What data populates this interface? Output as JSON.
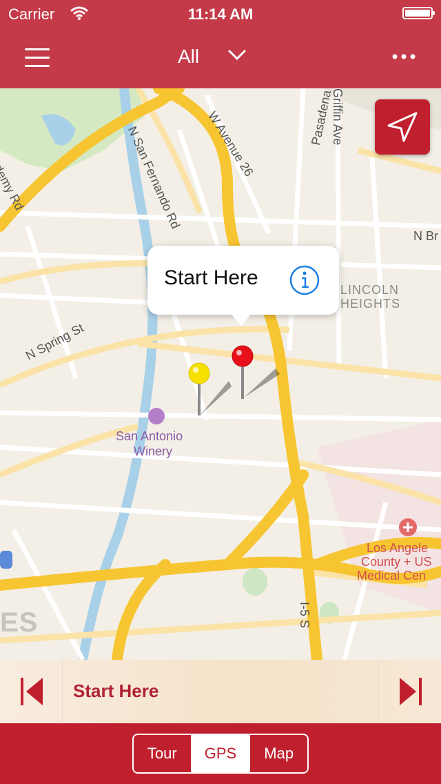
{
  "status_bar": {
    "carrier": "Carrier",
    "time": "11:14 AM"
  },
  "nav_bar": {
    "filter_label": "All",
    "menu_icon": "hamburger-icon",
    "more_icon": "ellipsis-icon",
    "dropdown_icon": "chevron-down-icon"
  },
  "map": {
    "streets": [
      "W Avenue 26",
      "N San Fernando Rd",
      "Pasadena",
      "Griffin Ave",
      "N Spring St",
      "N Br",
      "I-5 S",
      "ademy Rd"
    ],
    "districts": [
      "LINCOLN",
      "HEIGHTS",
      "ES"
    ],
    "pois": [
      "San Antonio",
      "Winery",
      "Los Angele",
      "County + US",
      "Medical Cen"
    ],
    "locate_icon": "location-arrow-icon"
  },
  "callout": {
    "title": "Start Here",
    "info_icon": "info-icon"
  },
  "pins": [
    {
      "color": "#f5e000",
      "name": "yellow-pin"
    },
    {
      "color": "#e8101a",
      "name": "red-pin"
    }
  ],
  "player": {
    "track_title": "Start Here",
    "prev_icon": "skip-previous-icon",
    "next_icon": "skip-next-icon"
  },
  "tabs": {
    "items": [
      "Tour",
      "GPS",
      "Map"
    ],
    "selected": "GPS"
  },
  "colors": {
    "brand_red": "#c43a49",
    "tab_red": "#c0202e",
    "road_yellow": "#f7c531"
  }
}
